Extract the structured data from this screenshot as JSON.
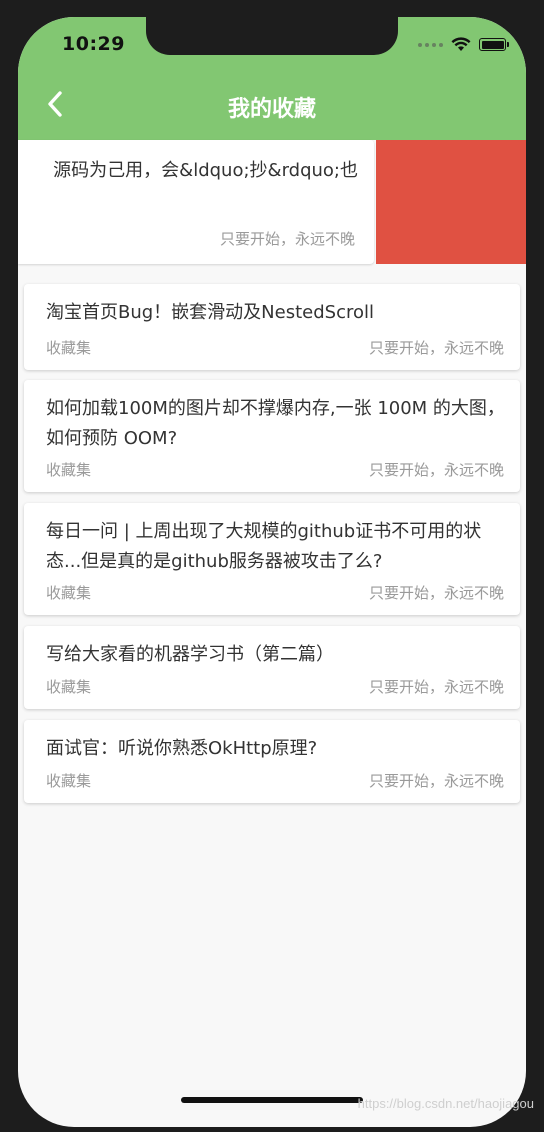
{
  "status_bar": {
    "time": "10:29"
  },
  "app_bar": {
    "title": "我的收藏"
  },
  "swiped_item": {
    "title": "源码为己用，会&ldquo;抄&rdquo;也",
    "author": "只要开始，永远不晚",
    "action_color": "#e05142"
  },
  "items": [
    {
      "title": "淘宝首页Bug！嵌套滑动及NestedScroll",
      "category": "收藏集",
      "author": "只要开始，永远不晚"
    },
    {
      "title": "如何加载100M的图片却不撑爆内存,一张 100M 的大图，如何预防 OOM?",
      "category": "收藏集",
      "author": "只要开始，永远不晚"
    },
    {
      "title": "每日一问 | 上周出现了大规模的github证书不可用的状态...但是真的是github服务器被攻击了么?",
      "category": "收藏集",
      "author": "只要开始，永远不晚"
    },
    {
      "title": "写给大家看的机器学习书（第二篇）",
      "category": "收藏集",
      "author": "只要开始，永远不晚"
    },
    {
      "title": "面试官：听说你熟悉OkHttp原理?",
      "category": "收藏集",
      "author": "只要开始，永远不晚"
    }
  ],
  "watermark": "https://blog.csdn.net/haojiagou",
  "colors": {
    "app_bar": "#82c772",
    "background": "#f8f8f8",
    "delete": "#e05142"
  }
}
